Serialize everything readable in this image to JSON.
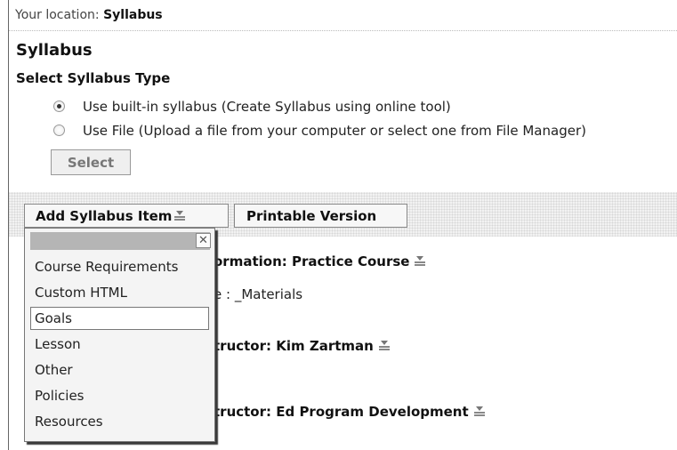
{
  "location": {
    "label": "Your location:",
    "current": "Syllabus"
  },
  "page_title": "Syllabus",
  "select_type": {
    "heading": "Select Syllabus Type",
    "options": [
      {
        "label": "Use built-in syllabus  (Create Syllabus using online tool)",
        "selected": true
      },
      {
        "label": "Use File  (Upload a file from your computer or select one from File Manager)",
        "selected": false
      }
    ],
    "button_label": "Select"
  },
  "toolbar": {
    "add_item_label": "Add Syllabus Item",
    "printable_label": "Printable Version"
  },
  "sections": [
    {
      "title_visible": "ormation: Practice Course",
      "detail_visible": "e : _Materials"
    },
    {
      "title_visible": "tructor: Kim Zartman"
    },
    {
      "title_visible": "tructor: Ed Program Development"
    }
  ],
  "add_item_menu": {
    "close_icon": "close-icon",
    "items": [
      "Course Requirements",
      "Custom HTML",
      "Goals",
      "Lesson",
      "Other",
      "Policies",
      "Resources"
    ],
    "highlighted": "Goals"
  },
  "colors": {
    "toolbar_bg": "#f2f2f2",
    "menu_header": "#b5b5b5",
    "button_disabled_text": "#777777"
  }
}
